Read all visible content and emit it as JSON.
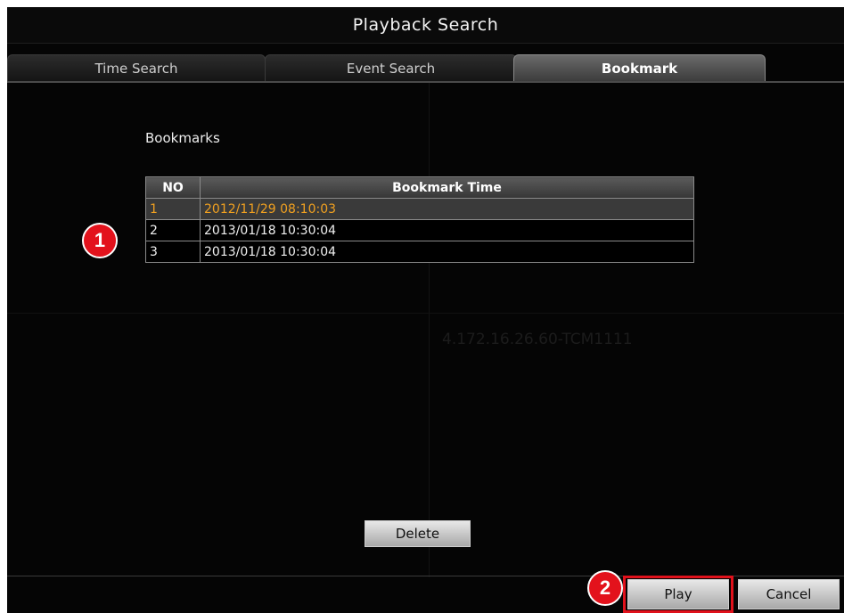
{
  "window": {
    "title": "Playback Search"
  },
  "tabs": [
    {
      "label": "Time Search",
      "active": false
    },
    {
      "label": "Event Search",
      "active": false
    },
    {
      "label": "Bookmark",
      "active": true
    }
  ],
  "bookmarks": {
    "section_label": "Bookmarks",
    "columns": [
      "NO",
      "Bookmark Time"
    ],
    "rows": [
      {
        "no": "1",
        "time": "2012/11/29 08:10:03",
        "selected": true
      },
      {
        "no": "2",
        "time": "2013/01/18 10:30:04",
        "selected": false
      },
      {
        "no": "3",
        "time": "2013/01/18 10:30:04",
        "selected": false
      }
    ]
  },
  "watermark": "4.172.16.26.60-TCM1111",
  "buttons": {
    "delete": "Delete",
    "play": "Play",
    "cancel": "Cancel"
  },
  "callouts": {
    "first": "1",
    "second": "2"
  },
  "colors": {
    "selected_text": "#f0a020",
    "callout": "#e3121c",
    "highlight_outline": "#e0111b"
  }
}
